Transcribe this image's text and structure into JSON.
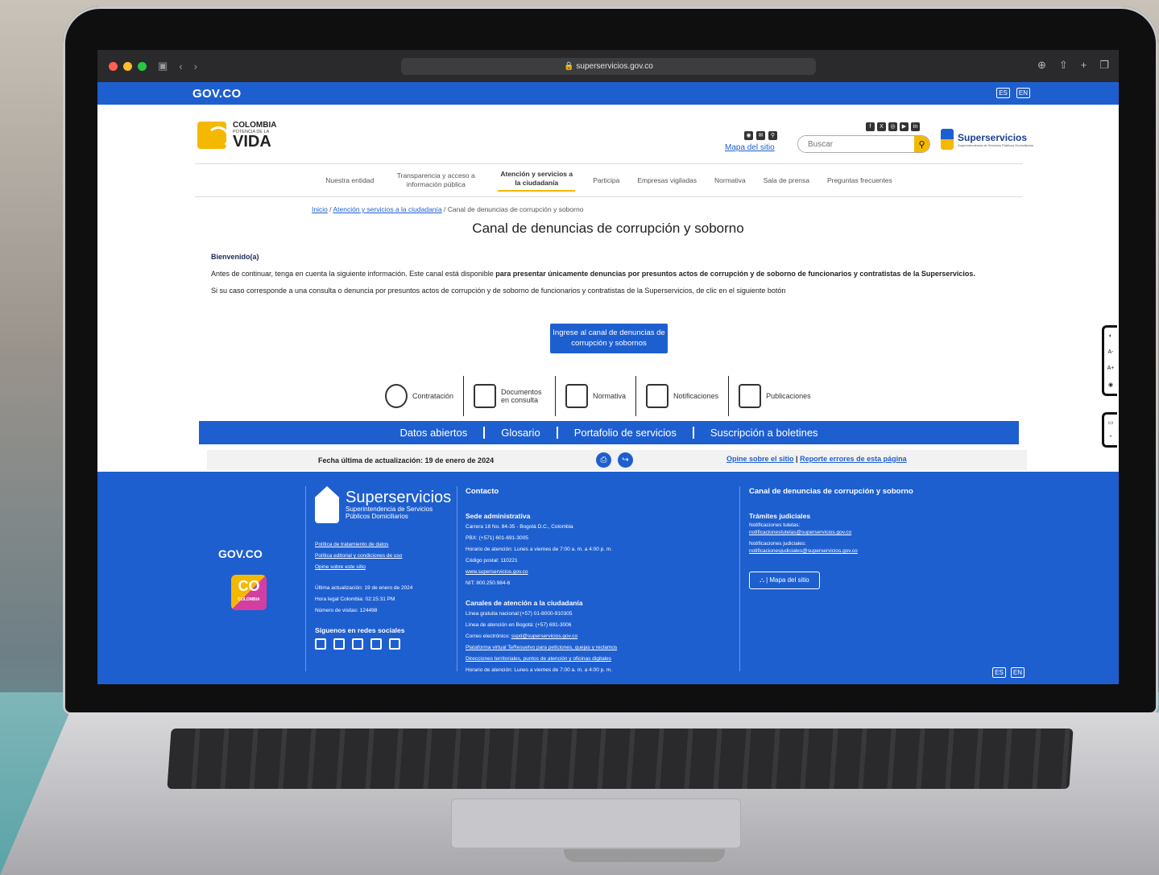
{
  "browser": {
    "url": "superservicios.gov.co"
  },
  "govbar": {
    "logo": "GOV.CO",
    "lang_es": "ES",
    "lang_en": "EN"
  },
  "header": {
    "logo_colombia": "COLOMBIA",
    "logo_potencia": "POTENCIA DE LA",
    "logo_vida": "VIDA",
    "mapa_sitio": "Mapa del sitio",
    "search_placeholder": "Buscar",
    "ss_name": "Superservicios",
    "ss_sub": "Superintendencia de Servicios Públicos Domiciliarios"
  },
  "nav": [
    {
      "label": "Nuestra entidad"
    },
    {
      "label": "Transparencia y acceso a información pública"
    },
    {
      "label": "Atención y servicios a la ciudadanía"
    },
    {
      "label": "Participa"
    },
    {
      "label": "Empresas vigiladas"
    },
    {
      "label": "Normativa"
    },
    {
      "label": "Sala de prensa"
    },
    {
      "label": "Preguntas frecuentes"
    }
  ],
  "breadcrumb": {
    "home": "Inicio",
    "section": "Atención y servicios a la ciudadanía",
    "current": "Canal de denuncias de corrupción y soborno"
  },
  "page": {
    "title": "Canal de denuncias de corrupción y soborno",
    "welcome": "Bienvenido(a)",
    "p1_start": "Antes de continuar, tenga en cuenta la siguiente información. Este canal está disponible ",
    "p1_bold": "para presentar únicamente denuncias por presuntos actos de corrupción y de soborno de funcionarios y contratistas de la Superservicios.",
    "p2": "Si su caso corresponde a una consulta o denuncia por presuntos actos de corrupción y de soborno de funcionarios y contratistas de la Superservicios, de clic en el siguiente botón",
    "cta": "Ingrese al canal de denuncias de corrupción y sobornos"
  },
  "shortcuts": [
    {
      "label": "Contratación",
      "icon": "person-icon"
    },
    {
      "label": "Documentos en consulta",
      "icon": "document-icon"
    },
    {
      "label": "Normativa",
      "icon": "building-icon"
    },
    {
      "label": "Notificaciones",
      "icon": "bell-icon"
    },
    {
      "label": "Publicaciones",
      "icon": "news-icon"
    }
  ],
  "bluebar": [
    "Datos abiertos",
    "Glosario",
    "Portafolio de servicios",
    "Suscripción a boletines"
  ],
  "update": {
    "text": "Fecha última de actualización: 19 de enero de 2024",
    "link1": "Opine sobre el sitio",
    "link2": "Reporte errores de esta página"
  },
  "footer": {
    "gov": "GOV.CO",
    "co": "CO",
    "co_sub": "COLOMBIA",
    "ss_name": "Superservicios",
    "ss_sub1": "Superintendencia de Servicios",
    "ss_sub2": "Públicos Domiciliarios",
    "link_datos": "Política de tratamiento de datos",
    "link_editorial": "Política editorial y condiciones de uso",
    "link_opine": "Opine sobre este sitio",
    "ultima": "Última actualización: 19 de enero de 2024",
    "hora": "Hora legal Colombia: 02:15:31 PM",
    "visitas": "Número de visitas: 124498",
    "redes": "Síguenos en redes sociales",
    "contacto": "Contacto",
    "sede": "Sede administrativa",
    "dir": "Carrera 18 No. 84-35 - Bogotá D.C., Colombia",
    "pbx": "PBX: (+571) 601-691-3005",
    "horario": "Horario de atención: Lunes a viernes de 7:00 a. m. a 4:00 p. m.",
    "postal": "Código postal: 110221",
    "web": "www.superservicios.gov.co",
    "nit": "NIT: 800.250.984-6",
    "canales": "Canales de atención a la ciudadanía",
    "linea": "Línea gratuita nacional:(+57) 01-8000-910305",
    "linea_bog": "Línea de atención en Bogotá: (+57) 691-3006",
    "correo_label": "Correo electrónico: ",
    "correo": "sspd@superservicios.gov.co",
    "plataforma": "Plataforma virtual TeResuelvo para peticiones, quejas y reclamos",
    "direcciones": "Direcciones territoriales, puntos de atención y oficinas digitales",
    "horario2": "Horario de atención: Lunes a viernes de 7:00 a. m. a 4:00 p. m.",
    "canal": "Canal de denuncias de corrupción y soborno",
    "tramites": "Trámites judiciales",
    "tutelas_label": "Notificaciones tutelas:",
    "tutelas": "notificacionestutelas@superservicios.gov.co",
    "judiciales_label": "Notificaciones judiciales:",
    "judiciales": "notificacionesjudiciales@superservicios.gov.co",
    "mapa": "Mapa del sitio",
    "lang_es": "ES",
    "lang_en": "EN"
  },
  "colors": {
    "brand_blue": "#1e5fd0",
    "accent_yellow": "#f5b800"
  }
}
